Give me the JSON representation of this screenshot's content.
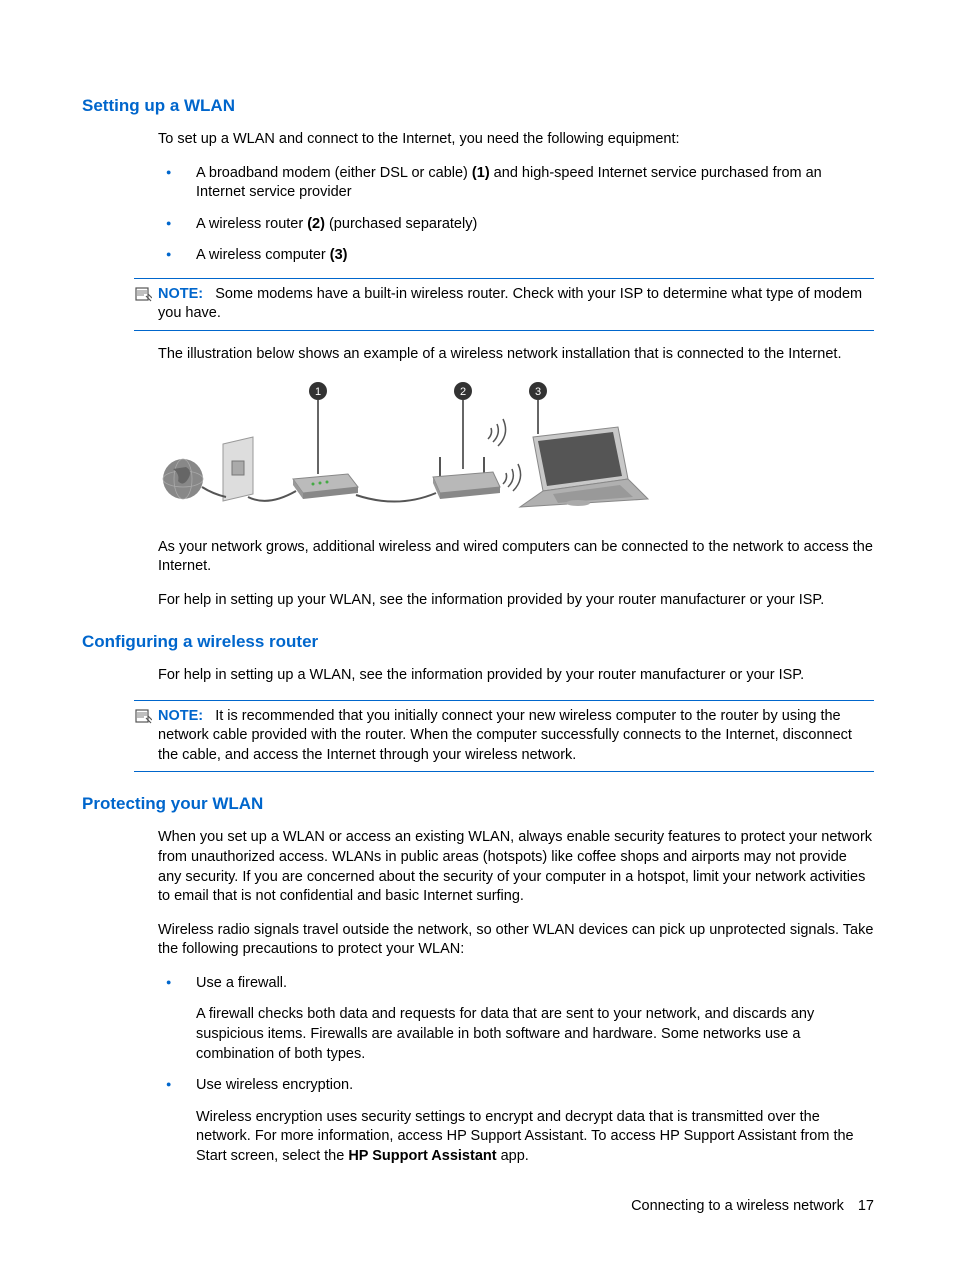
{
  "section1": {
    "heading": "Setting up a WLAN",
    "intro": "To set up a WLAN and connect to the Internet, you need the following equipment:",
    "bullets": {
      "b1_pre": "A broadband modem (either DSL or cable) ",
      "b1_bold": "(1)",
      "b1_post": " and high-speed Internet service purchased from an Internet service provider",
      "b2_pre": "A wireless router ",
      "b2_bold": "(2)",
      "b2_post": " (purchased separately)",
      "b3_pre": "A wireless computer ",
      "b3_bold": "(3)",
      "b3_post": ""
    },
    "note_label": "NOTE:",
    "note_body": "Some modems have a built-in wireless router. Check with your ISP to determine what type of modem you have.",
    "p2": "The illustration below shows an example of a wireless network installation that is connected to the Internet.",
    "p3": "As your network grows, additional wireless and wired computers can be connected to the network to access the Internet.",
    "p4": "For help in setting up your WLAN, see the information provided by your router manufacturer or your ISP."
  },
  "section2": {
    "heading": "Configuring a wireless router",
    "p1": "For help in setting up a WLAN, see the information provided by your router manufacturer or your ISP.",
    "note_label": "NOTE:",
    "note_body": "It is recommended that you initially connect your new wireless computer to the router by using the network cable provided with the router. When the computer successfully connects to the Internet, disconnect the cable, and access the Internet through your wireless network."
  },
  "section3": {
    "heading": "Protecting your WLAN",
    "p1": "When you set up a WLAN or access an existing WLAN, always enable security features to protect your network from unauthorized access. WLANs in public areas (hotspots) like coffee shops and airports may not provide any security. If you are concerned about the security of your computer in a hotspot, limit your network activities to email that is not confidential and basic Internet surfing.",
    "p2": "Wireless radio signals travel outside the network, so other WLAN devices can pick up unprotected signals. Take the following precautions to protect your WLAN:",
    "b1": "Use a firewall.",
    "b1_sub": "A firewall checks both data and requests for data that are sent to your network, and discards any suspicious items. Firewalls are available in both software and hardware. Some networks use a combination of both types.",
    "b2": "Use wireless encryption.",
    "b2_sub_pre": "Wireless encryption uses security settings to encrypt and decrypt data that is transmitted over the network. For more information, access HP Support Assistant. To access HP Support Assistant from the Start screen, select the ",
    "b2_sub_bold": "HP Support Assistant",
    "b2_sub_post": " app."
  },
  "footer": {
    "text": "Connecting to a wireless network",
    "page": "17"
  },
  "diagram": {
    "callout1": "1",
    "callout2": "2",
    "callout3": "3"
  }
}
